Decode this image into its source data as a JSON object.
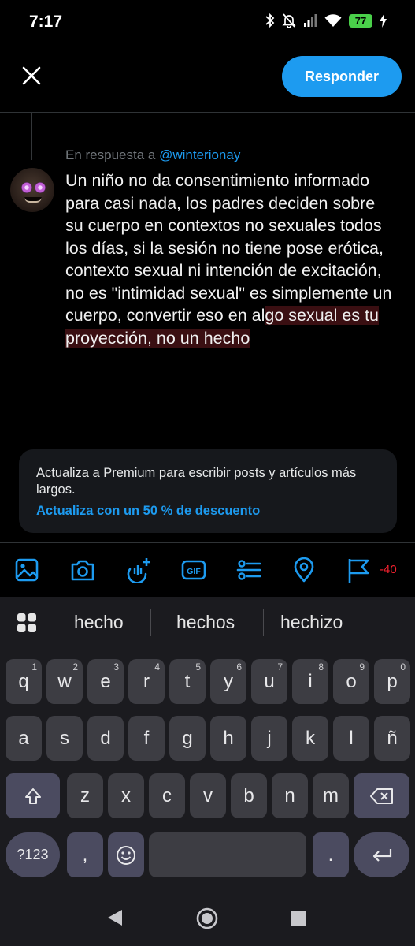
{
  "status": {
    "time": "7:17",
    "battery": "77"
  },
  "header": {
    "reply_button": "Responder"
  },
  "compose": {
    "reply_prefix": "En respuesta a",
    "reply_handle": "@winterionay",
    "text_plain": "Un niño no da consentimiento informado para casi nada, los padres deciden sobre su cuerpo en contextos no sexuales todos los días, si la sesión no tiene pose erótica, contexto sexual ni intención de excitación, no es \"intimidad sexual\" es simplemente un cuerpo, convertir eso en al",
    "text_over_limit": "go sexual es tu proyección, no un hecho"
  },
  "premium": {
    "text": "Actualiza a Premium para escribir posts y artículos más largos.",
    "link": "Actualiza con un 50 % de descuento"
  },
  "toolbar": {
    "icons": [
      "image-icon",
      "camera-icon",
      "grok-icon",
      "gif-icon",
      "poll-icon",
      "location-icon",
      "flag-icon"
    ],
    "char_count": "-40"
  },
  "keyboard": {
    "suggestions": [
      "hecho",
      "hechos",
      "hechizo"
    ],
    "row1": [
      {
        "k": "q",
        "s": "1"
      },
      {
        "k": "w",
        "s": "2"
      },
      {
        "k": "e",
        "s": "3"
      },
      {
        "k": "r",
        "s": "4"
      },
      {
        "k": "t",
        "s": "5"
      },
      {
        "k": "y",
        "s": "6"
      },
      {
        "k": "u",
        "s": "7"
      },
      {
        "k": "i",
        "s": "8"
      },
      {
        "k": "o",
        "s": "9"
      },
      {
        "k": "p",
        "s": "0"
      }
    ],
    "row2": [
      "a",
      "s",
      "d",
      "f",
      "g",
      "h",
      "j",
      "k",
      "l",
      "ñ"
    ],
    "row3": [
      "z",
      "x",
      "c",
      "v",
      "b",
      "n",
      "m"
    ],
    "symbols_key": "?123",
    "comma_key": ",",
    "period_key": "."
  },
  "colors": {
    "accent": "#1d9bf0",
    "over_limit": "#f4212e",
    "over_limit_bg": "#3a0f12"
  }
}
